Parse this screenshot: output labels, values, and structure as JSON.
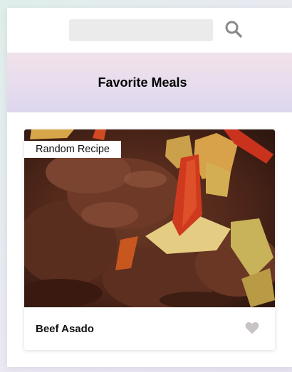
{
  "search": {
    "value": "",
    "placeholder": ""
  },
  "favorites": {
    "title": "Favorite Meals"
  },
  "meal": {
    "tag": "Random Recipe",
    "name": "Beef Asado"
  },
  "colors": {
    "heart": "#c8c3c6",
    "search_icon": "#8a8a8a"
  }
}
